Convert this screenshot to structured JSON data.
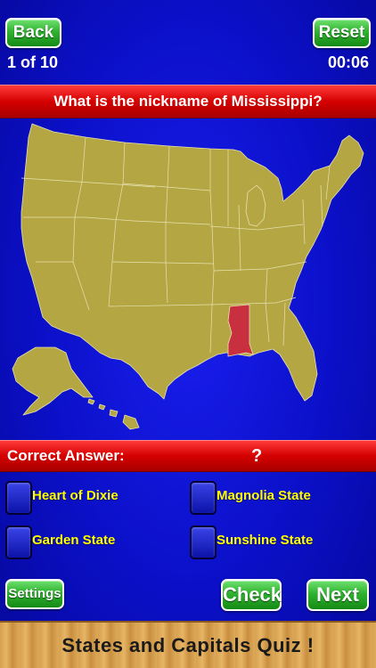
{
  "header": {
    "back_label": "Back",
    "reset_label": "Reset",
    "progress": "1 of 10",
    "timer": "00:06"
  },
  "question": {
    "text": "What is the nickname of Mississippi?"
  },
  "map": {
    "land_color": "#b5a644",
    "highlight_color": "#c8303f",
    "border_color": "#e7e2b0"
  },
  "answer": {
    "label": "Correct Answer:",
    "value": "?"
  },
  "choices": [
    {
      "label": "Heart of Dixie"
    },
    {
      "label": "Magnolia State"
    },
    {
      "label": "Garden State"
    },
    {
      "label": "Sunshine State"
    }
  ],
  "footer": {
    "settings_label": "Settings",
    "check_label": "Check",
    "next_label": "Next",
    "banner": "States and Capitals Quiz !"
  }
}
